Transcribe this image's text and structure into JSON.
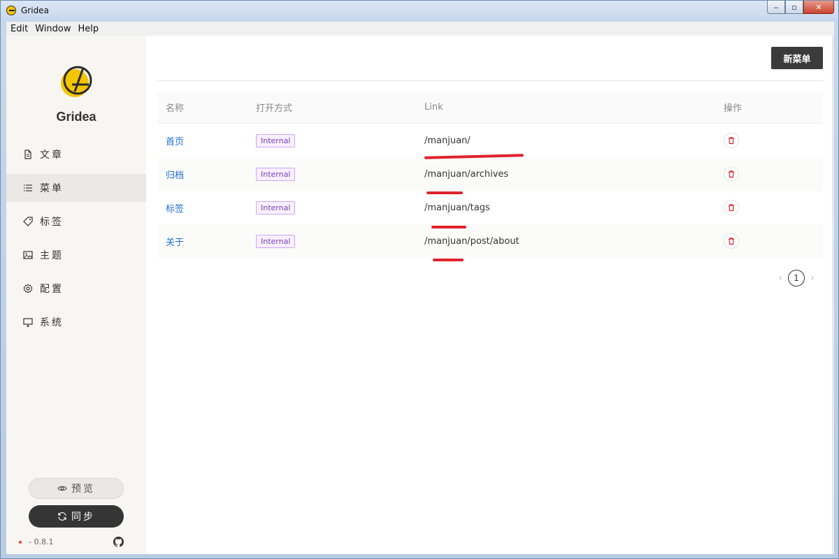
{
  "window": {
    "title": "Gridea"
  },
  "menubar": [
    "Edit",
    "Window",
    "Help"
  ],
  "sidebar": {
    "brand": "Gridea",
    "items": [
      {
        "label": "文章",
        "icon": "document-icon",
        "active": false
      },
      {
        "label": "菜单",
        "icon": "list-icon",
        "active": true
      },
      {
        "label": "标签",
        "icon": "tag-icon",
        "active": false
      },
      {
        "label": "主题",
        "icon": "image-icon",
        "active": false
      },
      {
        "label": "配置",
        "icon": "gear-icon",
        "active": false
      },
      {
        "label": "系统",
        "icon": "monitor-icon",
        "active": false
      }
    ],
    "preview_label": "预览",
    "sync_label": "同步",
    "version": "- 0.8.1"
  },
  "main": {
    "new_menu_label": "新菜单",
    "columns": [
      "名称",
      "打开方式",
      "Link",
      "操作"
    ],
    "rows": [
      {
        "name": "首页",
        "open_type": "Internal",
        "link": "/manjuan/"
      },
      {
        "name": "归档",
        "open_type": "Internal",
        "link": "/manjuan/archives"
      },
      {
        "name": "标签",
        "open_type": "Internal",
        "link": "/manjuan/tags"
      },
      {
        "name": "关于",
        "open_type": "Internal",
        "link": "/manjuan/post/about"
      }
    ],
    "pagination": {
      "current": "1"
    }
  },
  "colors": {
    "accent_dark": "#353535",
    "link": "#1f6fd1",
    "tag": "#7b3fb5",
    "danger": "#e0232d",
    "brand_yellow": "#f5c400"
  }
}
